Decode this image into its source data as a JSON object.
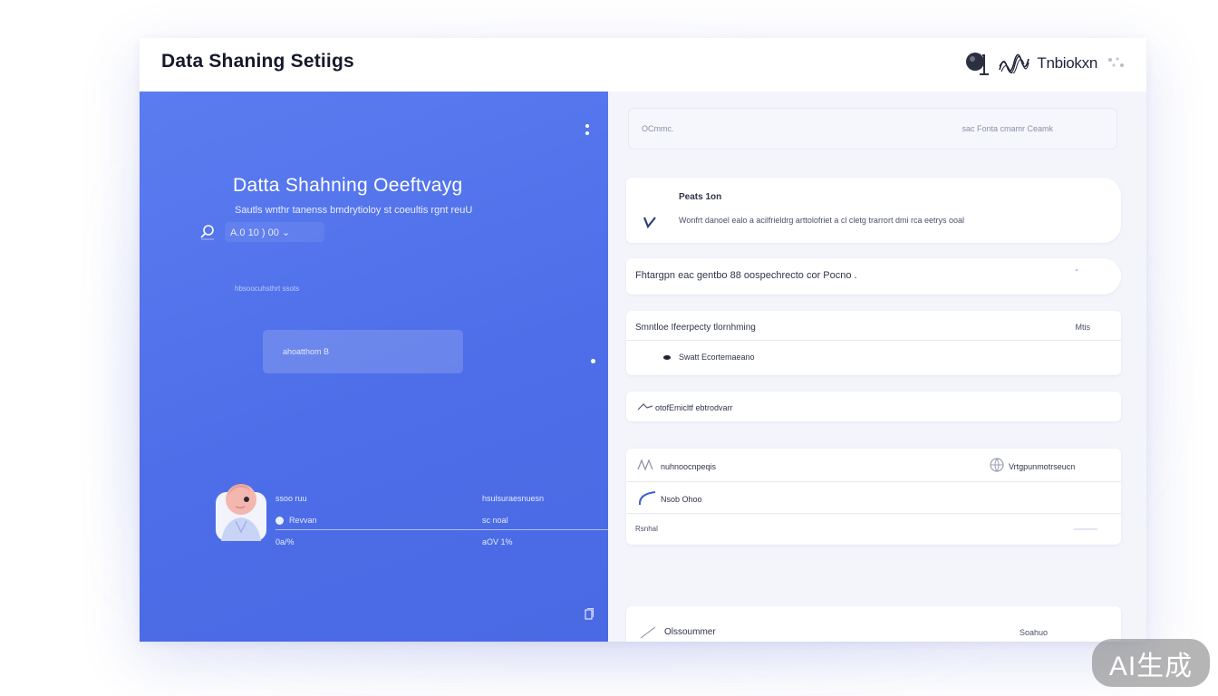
{
  "window": {
    "title": "Data Shaning Setiigs",
    "brand": {
      "name": "Tnbiokxn",
      "badge_icon": "logo-badge-icon",
      "wave_icon": "wave-icon"
    }
  },
  "left_panel": {
    "background_color": "#4f70ea",
    "heading": "Datta Shahning Oeeftvayg",
    "subtitle": "Sautls wnthr tanenss  bmdrytioloy st coeultis rgnt reuU",
    "search": {
      "value": "A.0    10    )    00  ⌄",
      "icon": "search-icon"
    },
    "caption": "hbsoocuhsthrt ssots",
    "button_label": "ahoatthom B",
    "profile": {
      "stat_labels": [
        "ssoo ruu",
        "Revvan",
        "0a/%"
      ],
      "stat_values": [
        "hsulsuraesnuesn",
        "sc noal",
        "aOV  1%"
      ]
    }
  },
  "right_panel": {
    "search_card": {
      "left_text": "OCmmc.",
      "right_text": "sac Fonta cmamr  Ceamk"
    },
    "info_card": {
      "title": "Peats 1on",
      "description": "Wonfrt danoel ealo a acilfrieldrg arttolofriet a cl cletg trarrort dmi rca eetrys ooal"
    },
    "permission_card": {
      "text": "Fhtargpn eac gentbo   88   oospechrecto cor Pocno  ."
    },
    "sharing_card": {
      "title": "Smntloe Ifeerpecty tlornhming",
      "title_right": "Mtis",
      "option": "Swatt Ecortemaeano"
    },
    "partner_card": {
      "text": "otofEmicltf ebtrodvarr"
    },
    "network_card": {
      "left_label": "nuhnoocnpeqis",
      "right_label": "Vrtgpunmotrseucn",
      "item": "Nsob Ohoo",
      "footer": "Rsnhal"
    },
    "bottom_card": {
      "left": "Olssoummer",
      "right": "Soahuo"
    }
  },
  "watermark": "AI生成"
}
